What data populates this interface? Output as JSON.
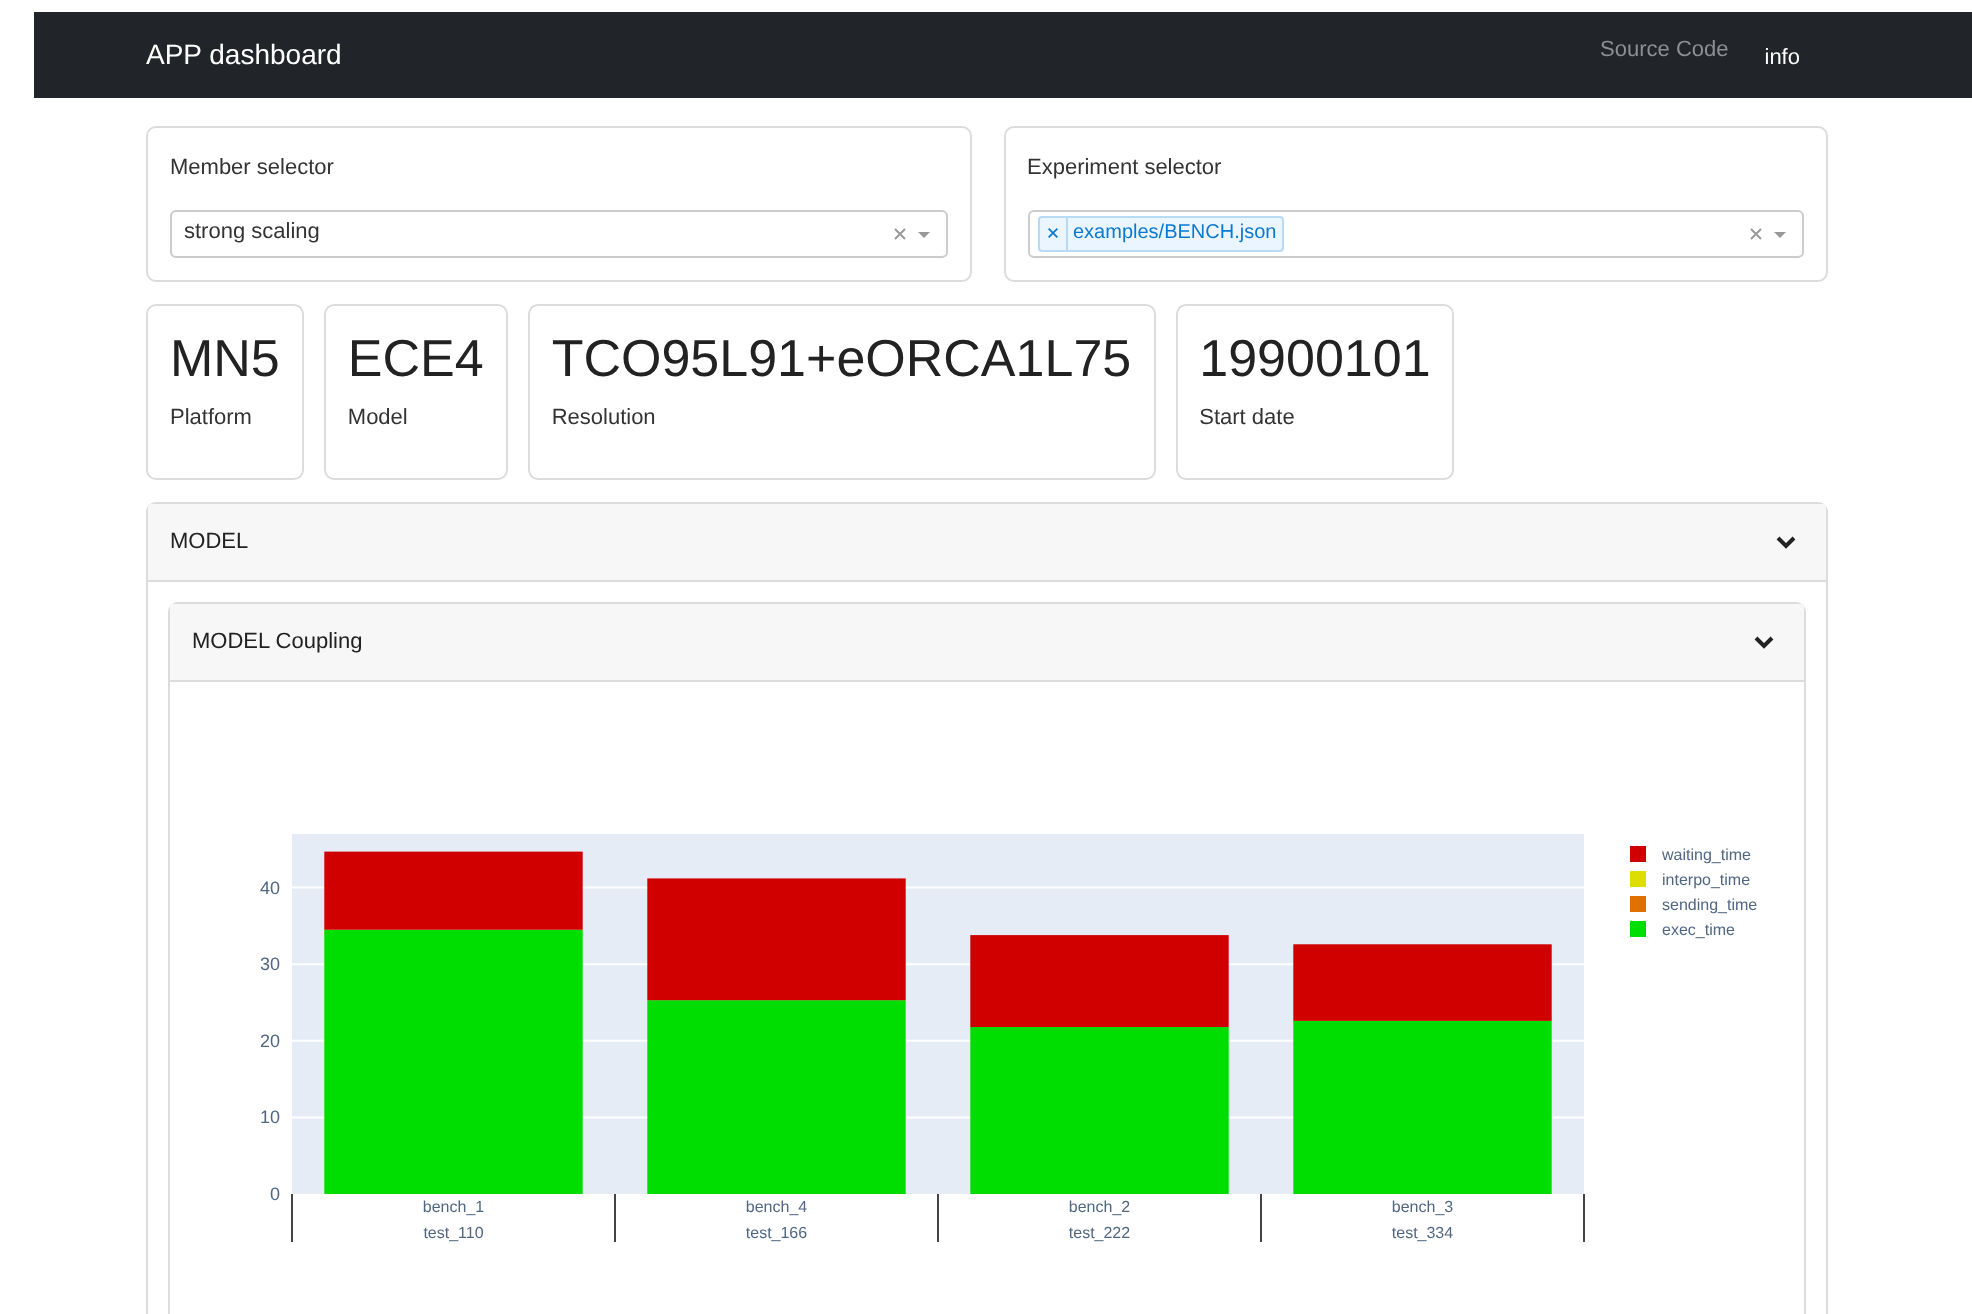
{
  "navbar": {
    "brand": "APP dashboard",
    "links": [
      {
        "label": "Source Code",
        "selected": false
      },
      {
        "label": "info",
        "selected": true
      }
    ]
  },
  "selectors": [
    {
      "label": "Member selector",
      "kind": "single",
      "value": "strong scaling"
    },
    {
      "label": "Experiment selector",
      "kind": "multi",
      "tags": [
        "examples/BENCH.json"
      ]
    }
  ],
  "info_cards": [
    {
      "value": "MN5",
      "label": "Platform"
    },
    {
      "value": "ECE4",
      "label": "Model"
    },
    {
      "value": "TCO95L91+eORCA1L75",
      "label": "Resolution"
    },
    {
      "value": "19900101",
      "label": "Start date"
    }
  ],
  "section": {
    "title": "MODEL",
    "expanded": true,
    "subsection": {
      "title": "MODEL Coupling",
      "expanded": true,
      "chart_data": {
        "type": "bar",
        "stacked": true,
        "grid": true,
        "legend": true,
        "categories": [
          "bench_1\ntest_110",
          "bench_4\ntest_166",
          "bench_2\ntest_222",
          "bench_3\ntest_334"
        ],
        "ylim": [
          0,
          47
        ],
        "yticks": [
          0,
          10,
          20,
          30,
          40
        ],
        "series": [
          {
            "name": "exec_time",
            "color": "#00dd00",
            "values": [
              34.5,
              25.3,
              21.8,
              22.6
            ]
          },
          {
            "name": "sending_time",
            "color": "#e07000",
            "values": [
              0,
              0,
              0,
              0
            ]
          },
          {
            "name": "interpo_time",
            "color": "#dddd00",
            "values": [
              0,
              0,
              0,
              0
            ]
          },
          {
            "name": "waiting_time",
            "color": "#d00000",
            "values": [
              10.2,
              15.9,
              12.0,
              10.0
            ]
          }
        ]
      }
    }
  }
}
